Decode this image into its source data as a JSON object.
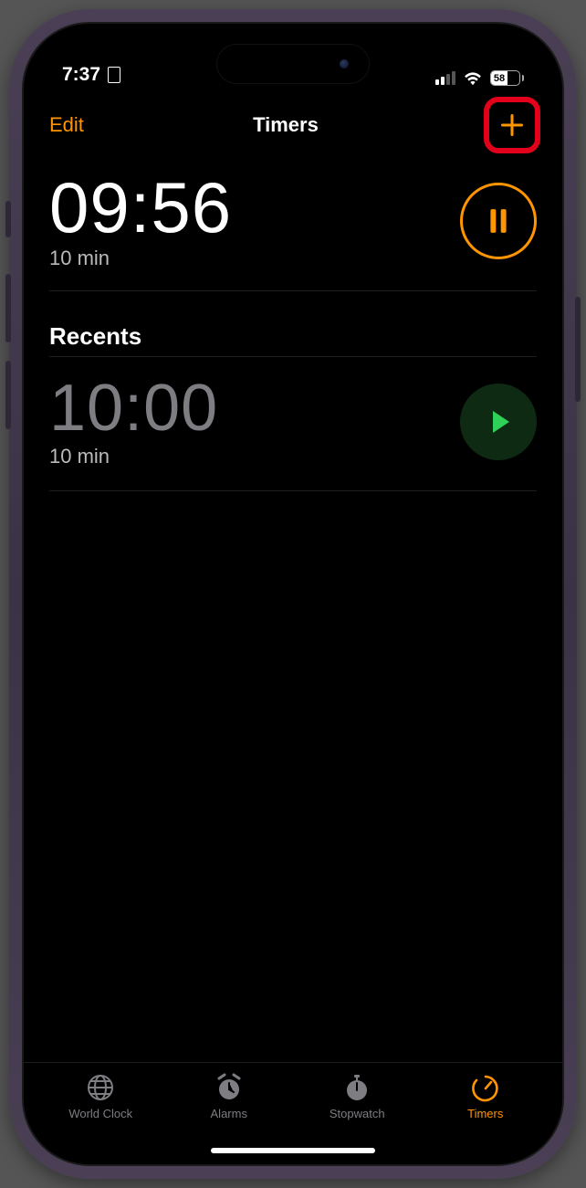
{
  "status": {
    "time": "7:37",
    "battery_pct": "58"
  },
  "navbar": {
    "edit": "Edit",
    "title": "Timers"
  },
  "active_timer": {
    "time": "09:56",
    "label": "10 min"
  },
  "recents": {
    "header": "Recents",
    "items": [
      {
        "time": "10:00",
        "label": "10 min"
      }
    ]
  },
  "tabs": {
    "world_clock": "World Clock",
    "alarms": "Alarms",
    "stopwatch": "Stopwatch",
    "timers": "Timers"
  },
  "annotation": {
    "highlight_target": "add-button"
  }
}
